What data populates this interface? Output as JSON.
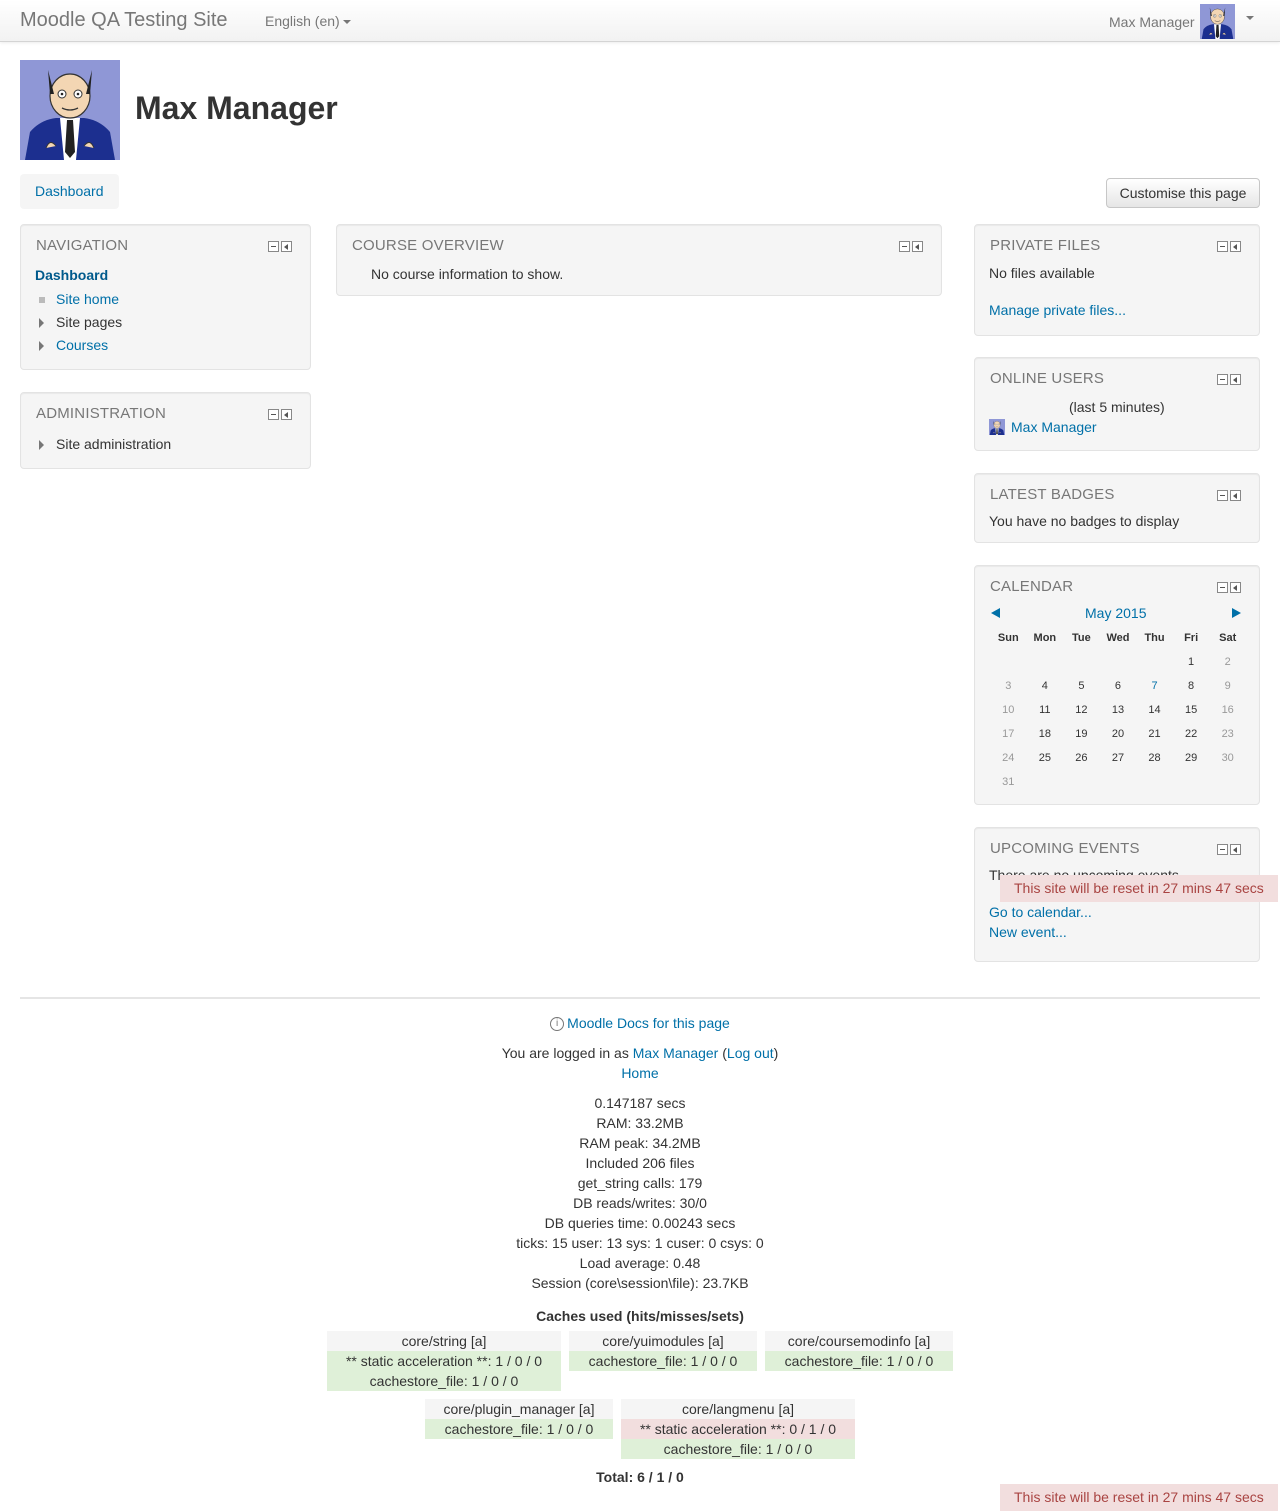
{
  "navbar": {
    "brand": "Moodle QA Testing Site",
    "language": "English ‎(en)‎",
    "user_name": "Max Manager"
  },
  "page": {
    "title": "Max Manager",
    "breadcrumb": "Dashboard",
    "customise_button": "Customise this page"
  },
  "navigation": {
    "title": "Navigation",
    "dashboard": "Dashboard",
    "items": [
      {
        "label": "Site home"
      },
      {
        "label": "Site pages"
      },
      {
        "label": "Courses"
      }
    ]
  },
  "administration": {
    "title": "Administration",
    "item": "Site administration"
  },
  "course_overview": {
    "title": "Course overview",
    "message": "No course information to show."
  },
  "private_files": {
    "title": "Private files",
    "message": "No files available",
    "link": "Manage private files..."
  },
  "online_users": {
    "title": "Online users",
    "period": "(last 5 minutes)",
    "user": "Max Manager"
  },
  "latest_badges": {
    "title": "Latest badges",
    "message": "You have no badges to display"
  },
  "calendar": {
    "title": "Calendar",
    "month": "May 2015",
    "days": [
      "Sun",
      "Mon",
      "Tue",
      "Wed",
      "Thu",
      "Fri",
      "Sat"
    ],
    "weeks": [
      [
        "",
        "",
        "",
        "",
        "",
        "1",
        "2"
      ],
      [
        "3",
        "4",
        "5",
        "6",
        "7",
        "8",
        "9"
      ],
      [
        "10",
        "11",
        "12",
        "13",
        "14",
        "15",
        "16"
      ],
      [
        "17",
        "18",
        "19",
        "20",
        "21",
        "22",
        "23"
      ],
      [
        "24",
        "25",
        "26",
        "27",
        "28",
        "29",
        "30"
      ],
      [
        "31",
        "",
        "",
        "",
        "",
        "",
        ""
      ]
    ],
    "linked_day": "7"
  },
  "upcoming_events": {
    "title": "Upcoming events",
    "message": "There are no upcoming events",
    "goto_link": "Go to calendar...",
    "new_event_link": "New event..."
  },
  "reset_notice": "This site will be reset in 27 mins 47 secs",
  "footer": {
    "docs_link": "Moodle Docs for this page",
    "logged_in_prefix": "You are logged in as",
    "user_link": "Max Manager",
    "logout_link": "Log out",
    "home_link": "Home",
    "stats": [
      "0.147187 secs",
      "RAM: 33.2MB",
      "RAM peak: 34.2MB",
      "Included 206 files",
      "get_string calls: 179",
      "DB reads/writes: 30/0",
      "DB queries time: 0.00243 secs",
      "ticks: 15 user: 13 sys: 1 cuser: 0 csys: 0",
      "Load average: 0.48",
      "Session (core\\session\\file): 23.7KB"
    ],
    "caches_title": "Caches used (hits/misses/sets)",
    "caches": [
      {
        "name": "core/string [a]",
        "rows": [
          "** static acceleration **: 1 / 0 / 0",
          "cachestore_file: 1 / 0 / 0"
        ]
      },
      {
        "name": "core/yuimodules [a]",
        "rows": [
          "cachestore_file: 1 / 0 / 0"
        ]
      },
      {
        "name": "core/coursemodinfo [a]",
        "rows": [
          "cachestore_file: 1 / 0 / 0"
        ]
      },
      {
        "name": "core/plugin_manager [a]",
        "rows": [
          "cachestore_file: 1 / 0 / 0"
        ]
      },
      {
        "name": "core/langmenu [a]",
        "rows": [
          "** static acceleration **: 0 / 1 / 0",
          "cachestore_file: 1 / 0 / 0"
        ]
      }
    ],
    "total": "Total: 6 / 1 / 0"
  },
  "colors": {
    "link": "#0070a8",
    "reset_bg": "#f2dede",
    "cache_hit": "#dff0d8",
    "cache_miss": "#f2dede"
  }
}
